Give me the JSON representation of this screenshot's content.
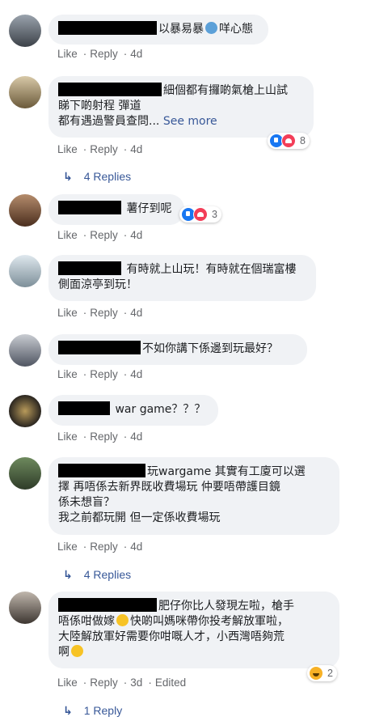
{
  "comments": [
    {
      "text": "以暴易暴",
      "text_after": "咩心態",
      "emoji": "fearful-face",
      "actions": {
        "like": "Like",
        "reply": "Reply",
        "time": "4d"
      }
    },
    {
      "line1": "細個都有攞啲氣槍上山試",
      "line2": "睇下啲射程 彈道",
      "line3": "都有遇過警員查問...",
      "see_more": "See more",
      "reaction_count": "8",
      "actions": {
        "like": "Like",
        "reply": "Reply",
        "time": "4d"
      },
      "replies": "4 Replies"
    },
    {
      "text": "薯仔到呢",
      "reaction_count": "3",
      "actions": {
        "like": "Like",
        "reply": "Reply",
        "time": "4d"
      }
    },
    {
      "line1": "有時就上山玩！有時就在個瑞富樓",
      "line2": "側面涼亭到玩！",
      "actions": {
        "like": "Like",
        "reply": "Reply",
        "time": "4d"
      }
    },
    {
      "text": "不如你講下係邊到玩最好？",
      "actions": {
        "like": "Like",
        "reply": "Reply",
        "time": "4d"
      }
    },
    {
      "text": "war game？？？",
      "actions": {
        "like": "Like",
        "reply": "Reply",
        "time": "4d"
      }
    },
    {
      "line1": "玩wargame 其實有工廈可以選",
      "line2": "擇 再唔係去新界既收費場玩 仲要唔帶護目鏡",
      "line3": "係未想盲？",
      "line4": "我之前都玩開 但一定係收費場玩",
      "actions": {
        "like": "Like",
        "reply": "Reply",
        "time": "4d"
      },
      "replies": "4 Replies"
    },
    {
      "line1": "肥仔你比人發現左啦，槍手",
      "line2a": "唔係咁做嫁",
      "line2b": "快啲叫媽咪帶你投考解放軍啦，",
      "line3": "大陸解放軍好需要你咁嘅人才，小西灣唔夠荒",
      "line4": "啊",
      "reaction_count": "2",
      "actions": {
        "like": "Like",
        "reply": "Reply",
        "time": "3d",
        "edited": "Edited"
      },
      "replies": "1 Reply"
    }
  ],
  "separator": "·"
}
